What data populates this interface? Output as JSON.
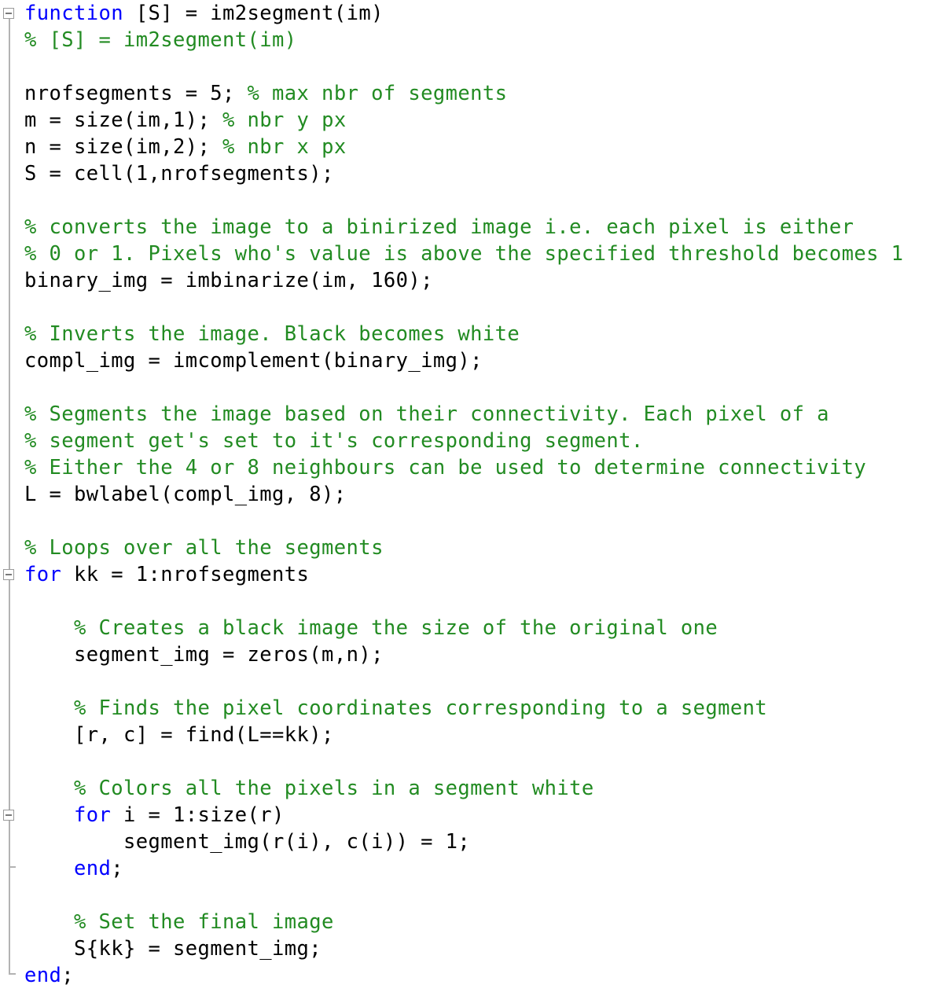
{
  "editor": {
    "language": "MATLAB",
    "colors": {
      "keyword": "#0000ff",
      "comment": "#228b22",
      "text": "#000000",
      "gutter": "#b3b3b3"
    },
    "lines": [
      {
        "indent": "",
        "segments": [
          {
            "t": "kw",
            "s": "function"
          },
          {
            "t": "tx",
            "s": " [S] = im2segment(im)"
          }
        ]
      },
      {
        "indent": "",
        "segments": [
          {
            "t": "cm",
            "s": "% [S] = im2segment(im)"
          }
        ]
      },
      {
        "indent": "",
        "segments": []
      },
      {
        "indent": "",
        "segments": [
          {
            "t": "tx",
            "s": "nrofsegments = 5; "
          },
          {
            "t": "cm",
            "s": "% max nbr of segments"
          }
        ]
      },
      {
        "indent": "",
        "segments": [
          {
            "t": "tx",
            "s": "m = size(im,1); "
          },
          {
            "t": "cm",
            "s": "% nbr y px"
          }
        ]
      },
      {
        "indent": "",
        "segments": [
          {
            "t": "tx",
            "s": "n = size(im,2); "
          },
          {
            "t": "cm",
            "s": "% nbr x px"
          }
        ]
      },
      {
        "indent": "",
        "segments": [
          {
            "t": "tx",
            "s": "S = cell(1,nrofsegments);"
          }
        ]
      },
      {
        "indent": "",
        "segments": []
      },
      {
        "indent": "",
        "segments": [
          {
            "t": "cm",
            "s": "% converts the image to a binirized image i.e. each pixel is either"
          }
        ]
      },
      {
        "indent": "",
        "segments": [
          {
            "t": "cm",
            "s": "% 0 or 1. Pixels who's value is above the specified threshold becomes 1"
          }
        ]
      },
      {
        "indent": "",
        "segments": [
          {
            "t": "tx",
            "s": "binary_img = imbinarize(im, 160);"
          }
        ]
      },
      {
        "indent": "",
        "segments": []
      },
      {
        "indent": "",
        "segments": [
          {
            "t": "cm",
            "s": "% Inverts the image. Black becomes white"
          }
        ]
      },
      {
        "indent": "",
        "segments": [
          {
            "t": "tx",
            "s": "compl_img = imcomplement(binary_img);"
          }
        ]
      },
      {
        "indent": "",
        "segments": []
      },
      {
        "indent": "",
        "segments": [
          {
            "t": "cm",
            "s": "% Segments the image based on their connectivity. Each pixel of a"
          }
        ]
      },
      {
        "indent": "",
        "segments": [
          {
            "t": "cm",
            "s": "% segment get's set to it's corresponding segment."
          }
        ]
      },
      {
        "indent": "",
        "segments": [
          {
            "t": "cm",
            "s": "% Either the 4 or 8 neighbours can be used to determine connectivity"
          }
        ]
      },
      {
        "indent": "",
        "segments": [
          {
            "t": "tx",
            "s": "L = bwlabel(compl_img, 8);"
          }
        ]
      },
      {
        "indent": "",
        "segments": []
      },
      {
        "indent": "",
        "segments": [
          {
            "t": "cm",
            "s": "% Loops over all the segments"
          }
        ]
      },
      {
        "indent": "",
        "segments": [
          {
            "t": "kw",
            "s": "for"
          },
          {
            "t": "tx",
            "s": " kk = 1:nrofsegments"
          }
        ]
      },
      {
        "indent": "",
        "segments": []
      },
      {
        "indent": "    ",
        "segments": [
          {
            "t": "cm",
            "s": "% Creates a black image the size of the original one"
          }
        ]
      },
      {
        "indent": "    ",
        "segments": [
          {
            "t": "tx",
            "s": "segment_img = zeros(m,n);"
          }
        ]
      },
      {
        "indent": "",
        "segments": []
      },
      {
        "indent": "    ",
        "segments": [
          {
            "t": "cm",
            "s": "% Finds the pixel coordinates corresponding to a segment"
          }
        ]
      },
      {
        "indent": "    ",
        "segments": [
          {
            "t": "tx",
            "s": "[r, c] = find(L==kk);"
          }
        ]
      },
      {
        "indent": "",
        "segments": []
      },
      {
        "indent": "    ",
        "segments": [
          {
            "t": "cm",
            "s": "% Colors all the pixels in a segment white"
          }
        ]
      },
      {
        "indent": "    ",
        "segments": [
          {
            "t": "kw",
            "s": "for"
          },
          {
            "t": "tx",
            "s": " i = 1:size(r)"
          }
        ]
      },
      {
        "indent": "        ",
        "segments": [
          {
            "t": "tx",
            "s": "segment_img(r(i), c(i)) = 1;"
          }
        ]
      },
      {
        "indent": "    ",
        "segments": [
          {
            "t": "kw",
            "s": "end"
          },
          {
            "t": "tx",
            "s": ";"
          }
        ]
      },
      {
        "indent": "",
        "segments": []
      },
      {
        "indent": "    ",
        "segments": [
          {
            "t": "cm",
            "s": "% Set the final image"
          }
        ]
      },
      {
        "indent": "    ",
        "segments": [
          {
            "t": "tx",
            "s": "S{kk} = segment_img;"
          }
        ]
      },
      {
        "indent": "",
        "segments": [
          {
            "t": "kw",
            "s": "end"
          },
          {
            "t": "tx",
            "s": ";"
          }
        ]
      }
    ]
  }
}
